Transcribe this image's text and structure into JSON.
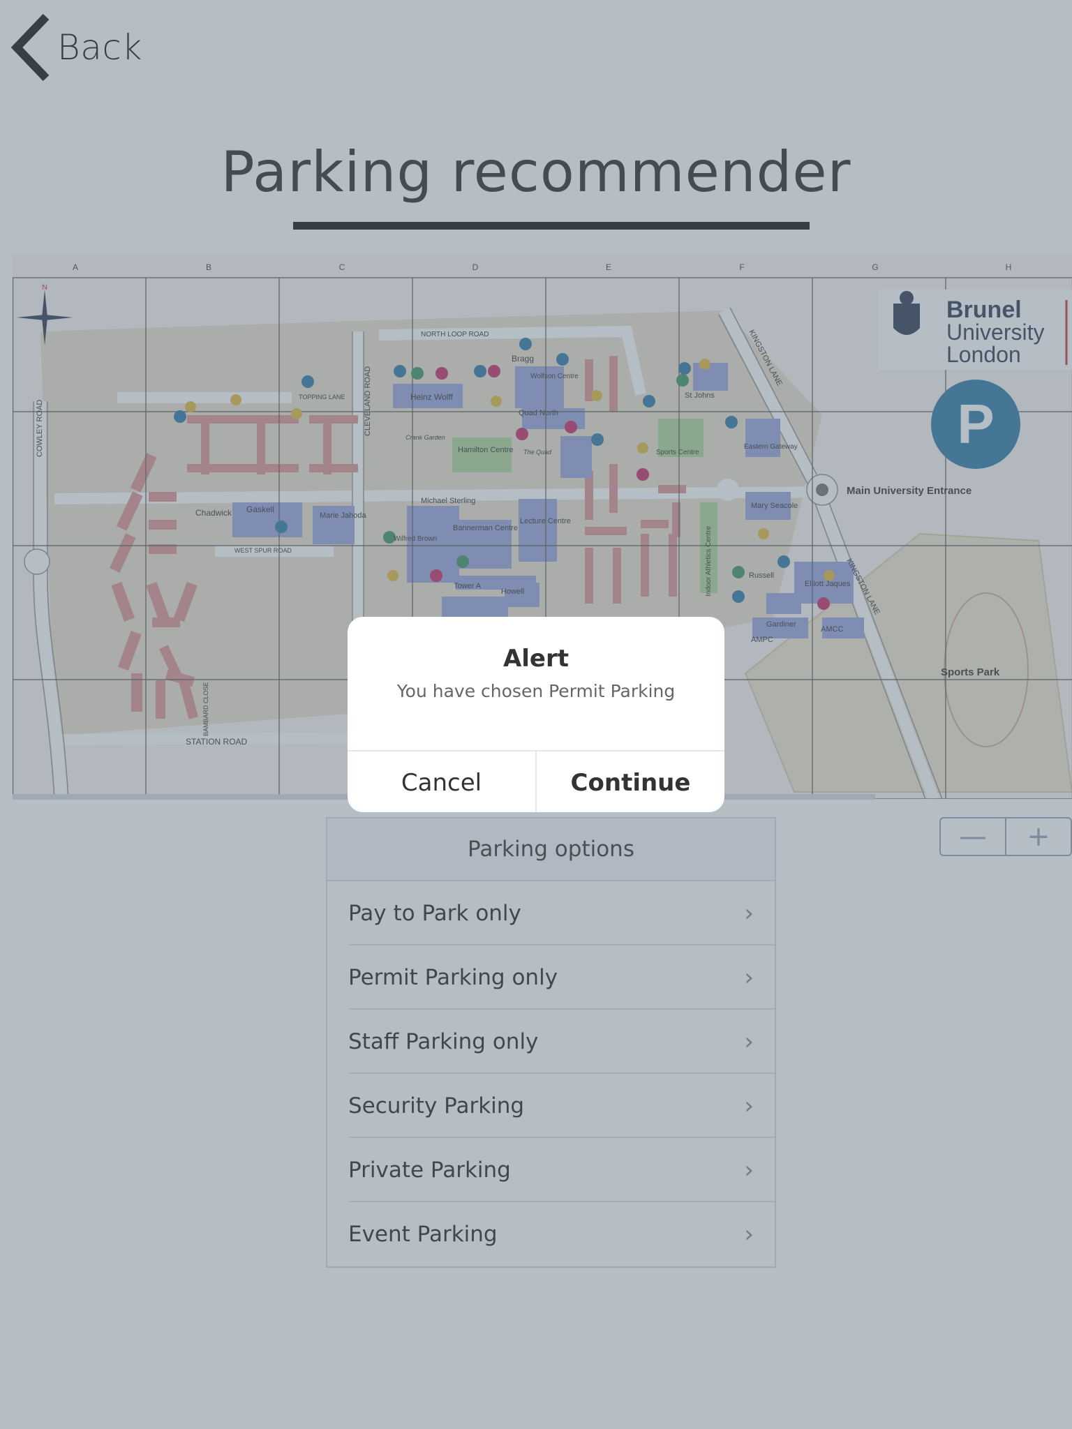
{
  "nav": {
    "back_label": "Back"
  },
  "page": {
    "title": "Parking recommender"
  },
  "map": {
    "grid_columns": [
      "A",
      "B",
      "C",
      "D",
      "E",
      "F",
      "G",
      "H"
    ],
    "compass_label": "N",
    "logo": {
      "line1": "Brunel",
      "line2": "University",
      "line3": "London"
    },
    "parking_badge": "P",
    "labels": {
      "cowley_road": "COWLEY ROAD",
      "cleveland_road": "CLEVELAND ROAD",
      "station_road": "STATION ROAD",
      "kingston_lane": "KINGSTON LANE",
      "north_loop_road": "NORTH LOOP ROAD",
      "topping_lane": "TOPPING LANE",
      "west_spur_road": "WEST SPUR ROAD",
      "bambard_close": "BAMBARD CLOSE",
      "main_entrance": "Main University Entrance",
      "sports_park": "Sports Park",
      "heinz_wolff": "Heinz Wolff",
      "bragg": "Bragg",
      "wolfson_centre": "Wolfson Centre",
      "quad_north": "Quad North",
      "hamilton_centre": "Hamilton Centre",
      "st_johns": "St Johns",
      "sports_centre": "Sports Centre",
      "eastern_gateway": "Eastern Gateway",
      "chadwick": "Chadwick",
      "gaskell": "Gaskell",
      "marie_jahoda": "Marie Jahoda",
      "michael_sterling": "Michael Sterling",
      "bannerman_centre": "Bannerman Centre",
      "lecture_centre": "Lecture Centre",
      "mary_seacole": "Mary Seacole",
      "russell": "Russell",
      "elliott_jaques": "Elliott Jaques",
      "gardiner": "Gardiner",
      "ampc": "AMPC",
      "amcc": "AMCC",
      "tower_a": "Tower A",
      "howell": "Howell",
      "indoor_athletics": "Indoor Athletics Centre",
      "wilfred_brown": "Wilfred Brown",
      "crank_garden": "Crank Garden",
      "the_quad": "The Quad"
    }
  },
  "zoom": {
    "out_label": "—",
    "in_label": "+"
  },
  "options": {
    "header": "Parking options",
    "items": [
      {
        "label": "Pay to Park only"
      },
      {
        "label": "Permit Parking only"
      },
      {
        "label": "Staff Parking only"
      },
      {
        "label": "Security Parking"
      },
      {
        "label": "Private Parking"
      },
      {
        "label": "Event Parking"
      }
    ],
    "chevron": "›"
  },
  "alert": {
    "title": "Alert",
    "message": "You have chosen Permit Parking",
    "cancel_label": "Cancel",
    "continue_label": "Continue"
  },
  "colors": {
    "accent_blue": "#1e6fa0",
    "logo_navy": "#1f2a44",
    "building_red": "#d98b8b",
    "building_blue": "#8f9dd6",
    "green_area": "#a9d08e"
  }
}
